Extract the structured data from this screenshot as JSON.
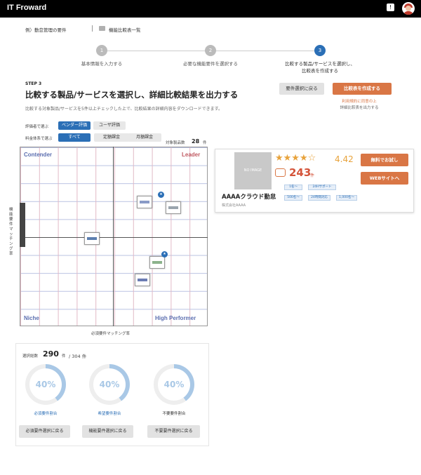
{
  "header": {
    "brand": "IT Froward"
  },
  "breadcrumb": {
    "current": "例）勤怠管理の要件",
    "next": "機能比較表一覧"
  },
  "steps": [
    {
      "number": "1",
      "label": "基本情報を入力する"
    },
    {
      "number": "2",
      "label": "必要な機能要件を選択する"
    },
    {
      "number": "3",
      "label_line1": "比較する製品/サービスを選択し、",
      "label_line2": "比較表を作成する"
    }
  ],
  "step_section": {
    "tag": "STEP 3",
    "title": "比較する製品/サービスを選択し、詳細比較結果を出力する",
    "description": "比較する対象製品/サービスを5件以上チェックした上で、比較結果の詳細内容をダウンロードできます。"
  },
  "actions": {
    "back_label": "要件選択に戻る",
    "create_label": "比較表を作成する",
    "note_line1": "利用規約に同意の上",
    "note_line2": "詳細比較表を出力する"
  },
  "filters": {
    "evaluation_label": "評価者で選ぶ",
    "evaluation_options": [
      "ベンダー評価",
      "ユーザ評価"
    ],
    "pricing_label": "料金体系で選ぶ",
    "pricing_options": [
      "すべて",
      "定額課金",
      "月額課金"
    ],
    "count_label": "対象製品数",
    "count_value": "28",
    "count_unit": "件"
  },
  "matrix": {
    "quadrants": {
      "top_left": "Contender",
      "top_right": "Leader",
      "bottom_left": "Niche",
      "bottom_right": "High Performer"
    },
    "x_axis_label": "必須要件マッチング率",
    "y_axis_label": "機能要件マッチング率",
    "marker_badges": [
      "★",
      "★",
      "★"
    ]
  },
  "selection": {
    "label": "選択総数",
    "value": "290",
    "unit": "件",
    "total": "/ 304 件",
    "rings": [
      {
        "value": "40%",
        "fraction": 0.4,
        "label": "必須要件割合",
        "label_color": "#2b6fb6",
        "button": "必須要件選択に戻る"
      },
      {
        "value": "40%",
        "fraction": 0.4,
        "label": "希望要件割合",
        "label_color": "#2b6fb6",
        "button": "機能要件選択に戻る"
      },
      {
        "value": "40%",
        "fraction": 0.4,
        "label": "不要要件割合",
        "label_color": "#333333",
        "button": "不要要件選択に戻る"
      }
    ]
  },
  "product": {
    "image_placeholder": "NO IMAGE",
    "stars": "★★★★☆",
    "rating": "4.42",
    "rating_value": 4.42,
    "reviews": "243",
    "reviews_unit": "件",
    "name": "AAAAクラウド勤怠",
    "company": "株式会社AAAA",
    "tags": [
      "1名〜",
      "24Hサポート",
      "500名〜",
      "24時間対応",
      "1,000名〜"
    ],
    "trial_label": "無料でお試し",
    "web_label": "WEBサイトへ"
  },
  "colors": {
    "accent_blue": "#2b6fb6",
    "accent_orange": "#d97645",
    "ring_fill": "#a9c8e6"
  }
}
